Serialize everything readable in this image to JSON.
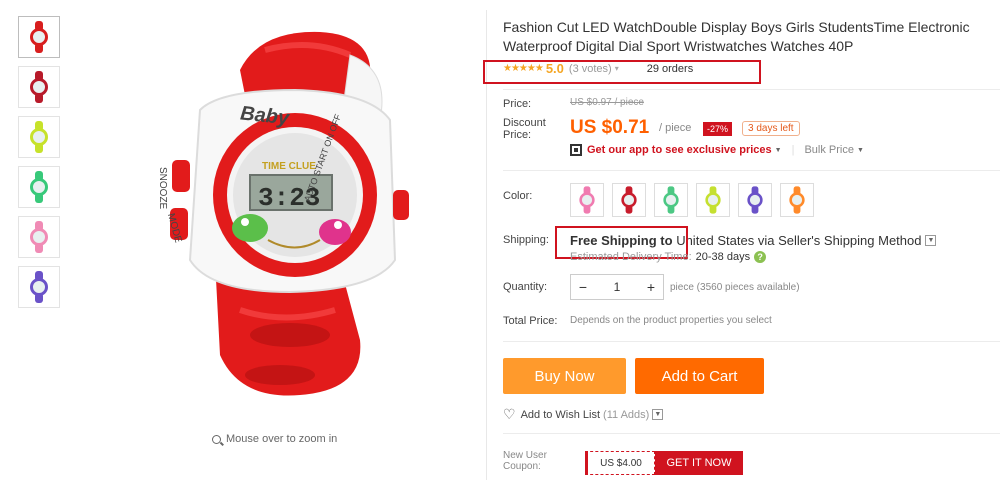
{
  "product": {
    "title": "Fashion Cut LED WatchDouble Display Boys Girls StudentsTime Electronic Waterproof Digital Dial Sport Wristwatches Watches 40P",
    "rating_stars": "★★★★★",
    "rating_score": "5.0",
    "votes": "(3 votes)",
    "orders": "29 orders"
  },
  "image": {
    "watch_brand": "Baby",
    "dial_label": "TIME CLUE",
    "display_time": "3:23",
    "left_buttons": "SNOOZE",
    "left_mode": "MODE",
    "right_bezel": "AUTO START ON OFF",
    "zoom_hint": "Mouse over to zoom in"
  },
  "thumbnails": [
    {
      "strap": "#d81e1e",
      "bezel": "#d81e1e"
    },
    {
      "strap": "#b81a2a",
      "bezel": "#b81a2a"
    },
    {
      "strap": "#c7e22a",
      "bezel": "#c7e22a"
    },
    {
      "strap": "#38c97a",
      "bezel": "#38c97a"
    },
    {
      "strap": "#f08bb5",
      "bezel": "#f08bb5"
    },
    {
      "strap": "#6a52c8",
      "bezel": "#6a52c8"
    }
  ],
  "price": {
    "label": "Price:",
    "original": "US $0.97 / piece",
    "discount_label_1": "Discount",
    "discount_label_2": "Price:",
    "current": "US $0.71",
    "unit": "/ piece",
    "discount_badge": "-27%",
    "days_left": "3 days left",
    "app_link": "Get our app to see exclusive prices",
    "bulk": "Bulk Price"
  },
  "color": {
    "label": "Color:",
    "swatches": [
      "#f07bb0",
      "#c81c2c",
      "#4cc884",
      "#c5e030",
      "#6a52c8",
      "#ff8a2a"
    ]
  },
  "shipping": {
    "label": "Shipping:",
    "free": "Free Shipping to",
    "destination": "United States via Seller's Shipping Method",
    "est_label": "Estimated Delivery Time:",
    "est_days": "20-38 days"
  },
  "quantity": {
    "label": "Quantity:",
    "minus": "−",
    "value": "1",
    "plus": "+",
    "note": "piece (3560 pieces available)"
  },
  "total": {
    "label": "Total Price:",
    "note": "Depends on the product properties you select"
  },
  "actions": {
    "buy_now": "Buy Now",
    "add_to_cart": "Add to Cart",
    "wish": "Add to Wish List",
    "wish_count": "(11 Adds)"
  },
  "coupon": {
    "label_1": "New User",
    "label_2": "Coupon:",
    "value": "US $4.00",
    "button": "GET IT NOW"
  }
}
